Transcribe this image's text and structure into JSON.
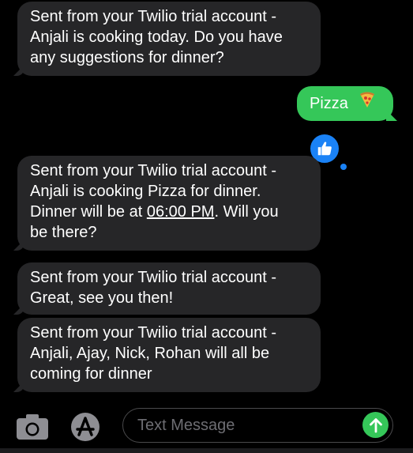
{
  "messages": [
    {
      "direction": "incoming",
      "lines": [
        "Sent from your Twilio trial account -",
        "Anjali is cooking today.  Do you have",
        "any suggestions for dinner?"
      ]
    },
    {
      "direction": "outgoing",
      "text": "Pizza",
      "emoji": "pizza-icon",
      "tapback": "thumbs-up-icon"
    },
    {
      "direction": "incoming",
      "lines": [
        "Sent from your Twilio trial account -",
        "Anjali is cooking Pizza for dinner.",
        "Dinner will be at ",
        "06:00 PM",
        ".  Will you",
        "be there?"
      ]
    },
    {
      "direction": "incoming",
      "lines": [
        "Sent from your Twilio trial account -",
        "Great, see you then!"
      ]
    },
    {
      "direction": "incoming",
      "lines": [
        "Sent from your Twilio trial account -",
        "Anjali, Ajay, Nick, Rohan will all be",
        "coming for dinner"
      ]
    }
  ],
  "input_bar": {
    "placeholder": "Text Message",
    "value": "",
    "camera_icon": "camera-icon",
    "apps_icon": "app-store-icon",
    "send_icon": "send-arrow-up-icon"
  },
  "colors": {
    "background": "#000000",
    "incoming_bubble": "#262628",
    "outgoing_bubble": "#35c759",
    "tapback": "#1a82f6",
    "send_button": "#35c759"
  }
}
